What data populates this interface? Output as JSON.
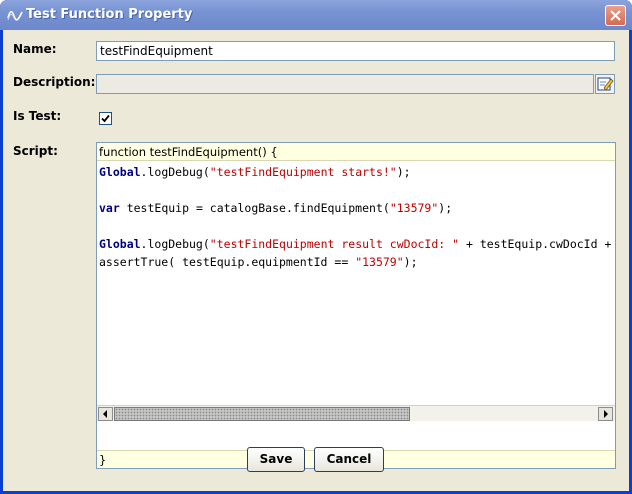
{
  "window": {
    "title": "Test Function Property"
  },
  "form": {
    "name_label": "Name:",
    "name_value": "testFindEquipment",
    "description_label": "Description:",
    "description_value": "",
    "is_test_label": "Is Test:",
    "is_test_checked": true,
    "script_label": "Script:"
  },
  "script": {
    "header": "function testFindEquipment() {",
    "footer": "}",
    "lines": [
      [
        {
          "t": "Global",
          "c": "kw"
        },
        {
          "t": ".logDebug(",
          "c": ""
        },
        {
          "t": "\"testFindEquipment starts!\"",
          "c": "str"
        },
        {
          "t": ");",
          "c": ""
        }
      ],
      [],
      [
        {
          "t": "var",
          "c": "kw"
        },
        {
          "t": " testEquip = catalogBase.findEquipment(",
          "c": ""
        },
        {
          "t": "\"13579\"",
          "c": "str"
        },
        {
          "t": ");",
          "c": ""
        }
      ],
      [],
      [
        {
          "t": "Global",
          "c": "kw"
        },
        {
          "t": ".logDebug(",
          "c": ""
        },
        {
          "t": "\"testFindEquipment result cwDocId: \"",
          "c": "str"
        },
        {
          "t": " + testEquip.cwDocId +",
          "c": ""
        }
      ],
      [
        {
          "t": "assertTrue( testEquip.equipmentId == ",
          "c": ""
        },
        {
          "t": "\"13579\"",
          "c": "str"
        },
        {
          "t": ");",
          "c": ""
        }
      ]
    ]
  },
  "buttons": {
    "save": "Save",
    "cancel": "Cancel"
  },
  "colors": {
    "title_bar": "#7793d3",
    "dialog_bg": "#ece9d8",
    "keyword": "#00007f",
    "string": "#c00000",
    "script_margin_bg": "#ffffe1"
  },
  "icons": {
    "window": "wave-icon",
    "close": "close-icon",
    "edit": "edit-pencil-icon",
    "check": "checkmark-icon",
    "scroll_left": "arrow-left-icon",
    "scroll_right": "arrow-right-icon"
  }
}
